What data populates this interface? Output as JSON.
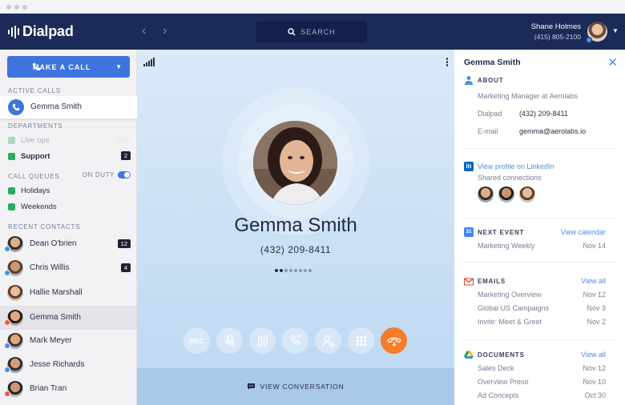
{
  "header": {
    "brand": "Dialpad",
    "search_label": "SEARCH",
    "user_name": "Shane Holmes",
    "user_phone": "(415) 805-2100"
  },
  "sidebar": {
    "make_call_label": "MAKE A CALL",
    "active_calls_heading": "ACTIVE CALLS",
    "active_call_name": "Gemma Smith",
    "departments_heading": "DEPARTMENTS",
    "departments": [
      {
        "label": "Live ops",
        "status": "OFF",
        "color": "#2bab5b"
      },
      {
        "label": "Support",
        "badge": "2",
        "color": "#2bab5b"
      }
    ],
    "call_queues_heading": "CALL QUEUES",
    "on_duty_label": "ON DUTY",
    "on_duty": true,
    "call_queues": [
      {
        "label": "Holidays",
        "color": "#2bab5b"
      },
      {
        "label": "Weekends",
        "color": "#2bab5b"
      }
    ],
    "recent_contacts_heading": "RECENT CONTACTS",
    "contacts": [
      {
        "name": "Dean O'brien",
        "badge": "12"
      },
      {
        "name": "Chris Willis",
        "badge": "4"
      },
      {
        "name": "Hallie Marshall"
      },
      {
        "name": "Gemma Smith"
      },
      {
        "name": "Mark Meyer"
      },
      {
        "name": "Jesse Richards"
      },
      {
        "name": "Brian Tran"
      }
    ]
  },
  "call": {
    "name": "Gemma Smith",
    "number": "(432) 209-8411",
    "controls": [
      {
        "label": "REC",
        "icon": "record-icon"
      },
      {
        "label": "",
        "icon": "mute-icon"
      },
      {
        "label": "",
        "icon": "hold-icon"
      },
      {
        "label": "",
        "icon": "transfer-icon"
      },
      {
        "label": "",
        "icon": "add-person-icon"
      },
      {
        "label": "",
        "icon": "keypad-icon"
      },
      {
        "label": "",
        "icon": "hangup-icon"
      }
    ],
    "view_conversation_label": "VIEW CONVERSATION"
  },
  "contact_panel": {
    "name": "Gemma Smith",
    "about_heading": "ABOUT",
    "title": "Marketing Manager at Aerolabs",
    "dialpad_label": "Dialpad",
    "dialpad_value": "(432) 209-8411",
    "email_label": "E-mail",
    "email_value": "gemma@aerolabs.io",
    "linkedin_link": "View profile on LinkedIn",
    "shared_connections": "Shared connections",
    "next_event_heading": "NEXT EVENT",
    "view_calendar": "View calendar",
    "next_event": {
      "title": "Marketing Weekly",
      "date": "Nov 14"
    },
    "calendar_icon_text": "31",
    "emails_heading": "EMAILS",
    "emails_view_all": "View all",
    "emails": [
      {
        "subject": "Marketing Overview",
        "date": "Nov 12"
      },
      {
        "subject": "Global US Campaigns",
        "date": "Nov 9"
      },
      {
        "subject": "Invite: Meet & Greet",
        "date": "Nov 2"
      }
    ],
    "documents_heading": "DOCUMENTS",
    "documents_view_all": "View all",
    "documents": [
      {
        "name": "Sales Deck",
        "date": "Nov 12"
      },
      {
        "name": "Overview Preso",
        "date": "Nov 10"
      },
      {
        "name": "Ad Concepts",
        "date": "Oct 30"
      }
    ]
  },
  "colors": {
    "brand_navy": "#1b2a56",
    "accent_blue": "#3f74de",
    "end_call_orange": "#f57c2b",
    "status_green": "#2bab5b"
  }
}
